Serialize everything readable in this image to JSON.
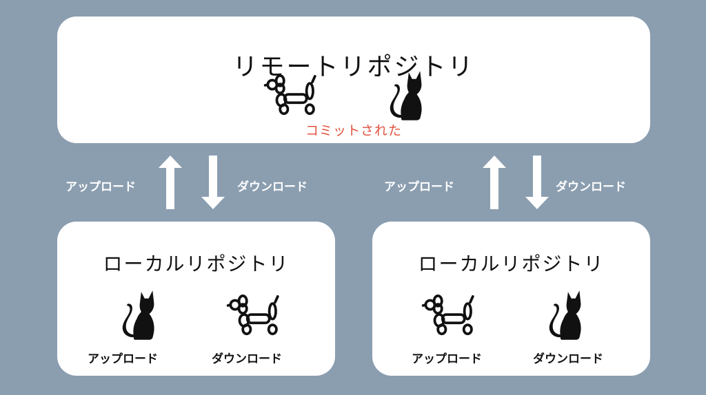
{
  "remote": {
    "title": "リモートリポジトリ",
    "commit_label": "コミットされた",
    "icons": [
      "balloon-dog-icon",
      "cat-icon"
    ]
  },
  "sync_labels": {
    "upload": "アップロード",
    "download": "ダウンロード"
  },
  "local_left": {
    "title": "ローカルリポジトリ",
    "items": [
      {
        "icon": "cat-icon",
        "caption": "アップロード"
      },
      {
        "icon": "balloon-dog-icon",
        "caption": "ダウンロード"
      }
    ]
  },
  "local_right": {
    "title": "ローカルリポジトリ",
    "items": [
      {
        "icon": "balloon-dog-icon",
        "caption": "アップロード"
      },
      {
        "icon": "cat-icon",
        "caption": "ダウンロード"
      }
    ]
  },
  "colors": {
    "background": "#8b9eb0",
    "box": "#ffffff",
    "commit": "#e0533f",
    "arrow": "#ffffff"
  }
}
